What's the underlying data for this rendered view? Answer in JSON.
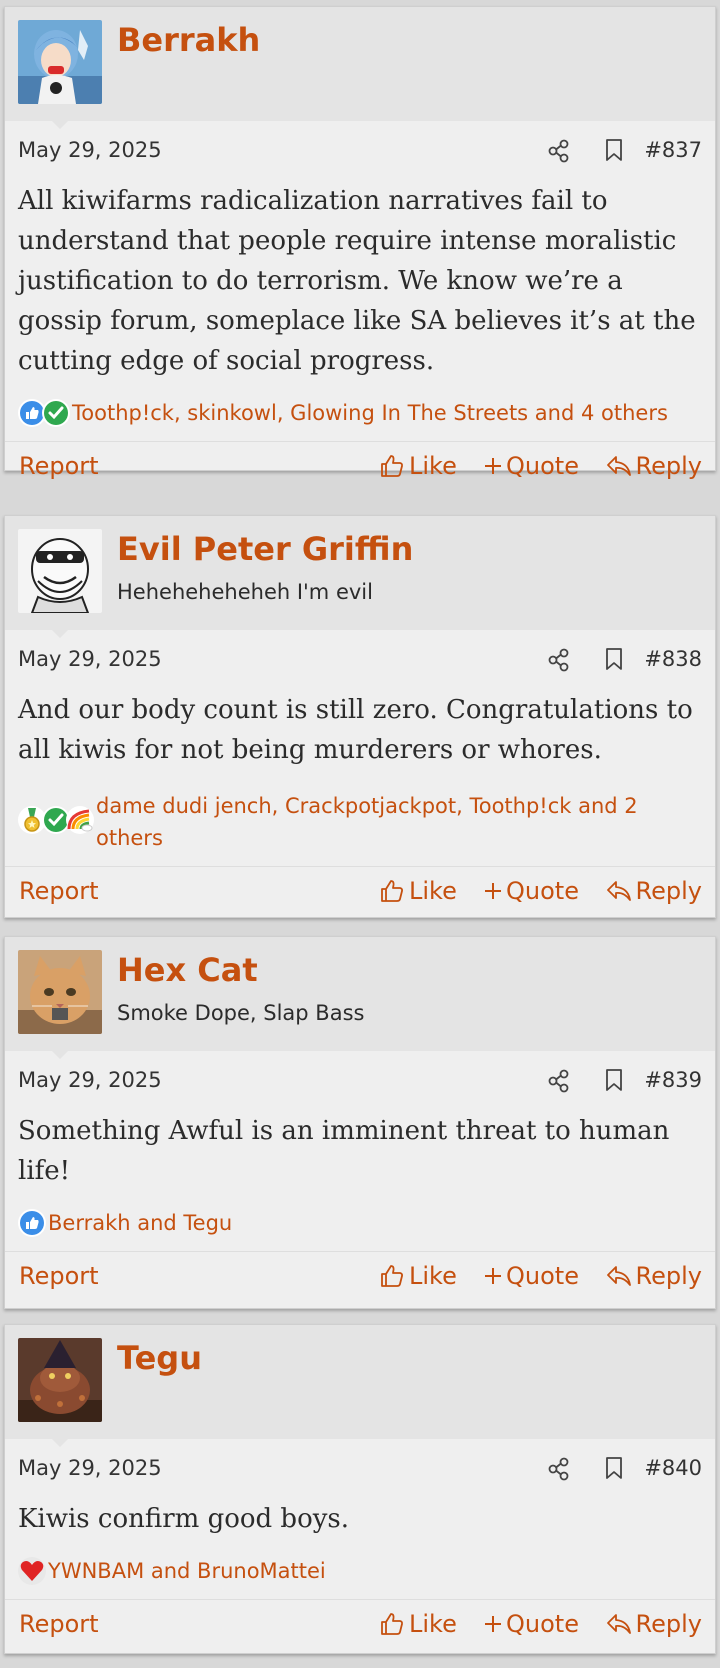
{
  "posts": [
    {
      "username": "Berrakh",
      "user_title": "",
      "avatar": "anime-girl-avatar",
      "date": "May 29, 2025",
      "number": "#837",
      "body": "All kiwifarms radicalization narratives fail to understand that people require intense moralistic justification to do terrorism. We know we’re a gossip forum, someplace like SA believes it’s at the cutting edge of social progress.",
      "reactions": [
        "like-reaction-icon",
        "agree-check-icon"
      ],
      "reaction_users": "Toothp!ck, skinkowl, Glowing In The Streets and 4 others"
    },
    {
      "username": "Evil Peter Griffin",
      "user_title": "Heheheheheheh I'm evil",
      "avatar": "evil-cartoon-avatar",
      "date": "May 29, 2025",
      "number": "#838",
      "body": "And our body count is still zero. Congratulations to all kiwis for not being murderers or whores.",
      "reactions": [
        "medal-icon",
        "agree-check-icon",
        "rainbow-icon"
      ],
      "reaction_users": "dame dudi jench, Crackpotjackpot, Toothp!ck and 2 others"
    },
    {
      "username": "Hex Cat",
      "user_title": "Smoke Dope, Slap Bass",
      "avatar": "orange-cat-avatar",
      "date": "May 29, 2025",
      "number": "#839",
      "body": "Something Awful is an imminent threat to human life!",
      "reactions": [
        "like-reaction-icon"
      ],
      "reaction_users": "Berrakh and Tegu"
    },
    {
      "username": "Tegu",
      "user_title": "",
      "avatar": "lizard-wizard-avatar",
      "date": "May 29, 2025",
      "number": "#840",
      "body": "Kiwis confirm good boys.",
      "reactions": [
        "heart-icon"
      ],
      "reaction_users": "YWNBAM and BrunoMattei"
    }
  ],
  "actions": {
    "report": "Report",
    "like": "Like",
    "quote": "Quote",
    "reply": "Reply"
  },
  "colors": {
    "accent": "#c5500f",
    "header_bg": "#e4e4e4",
    "post_bg": "#efefef"
  }
}
